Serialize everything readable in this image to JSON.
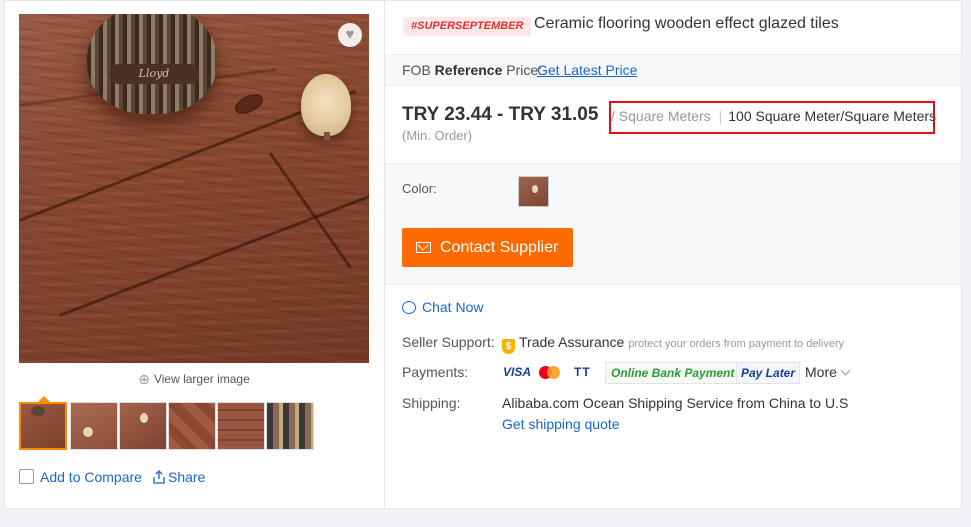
{
  "gallery": {
    "basket_text": "Lloyd",
    "view_larger": "View larger image",
    "thumbnail_count": 6,
    "active_thumbnail": 1
  },
  "actions": {
    "compare": "Add to Compare",
    "share": "Share"
  },
  "product": {
    "badge": "#SUPERSEPTEMBER",
    "title": "Ceramic flooring wooden effect glazed tiles"
  },
  "fob": {
    "label_prefix": "FOB ",
    "label_bold": "Reference",
    "label_suffix": " Price:",
    "link": "Get Latest Price"
  },
  "pricing": {
    "range": "TRY 23.44 - TRY 31.05",
    "unit": "/ Square Meters",
    "separator": "|",
    "moq": "100 Square Meter/Square Meters",
    "min_order": "(Min. Order)"
  },
  "options": {
    "color_label": "Color:",
    "contact_button": "Contact Supplier"
  },
  "chat": {
    "label": "Chat Now"
  },
  "seller_support": {
    "label": "Seller Support:",
    "value": "Trade Assurance",
    "note": "protect your orders from payment to delivery",
    "shield_symbol": "$"
  },
  "payments": {
    "label": "Payments:",
    "visa": "VISA",
    "tt": "TT",
    "online_bank": "Online Bank Payment",
    "pay_later": "Pay Later",
    "more": "More"
  },
  "shipping": {
    "label": "Shipping:",
    "value": "Alibaba.com Ocean Shipping Service from China to U.S",
    "link": "Get shipping quote"
  },
  "colors": {
    "accent_orange": "#ff6a00",
    "link_blue": "#1a66c9",
    "highlight_red": "#e0101b",
    "badge_red": "#e62e2e"
  }
}
